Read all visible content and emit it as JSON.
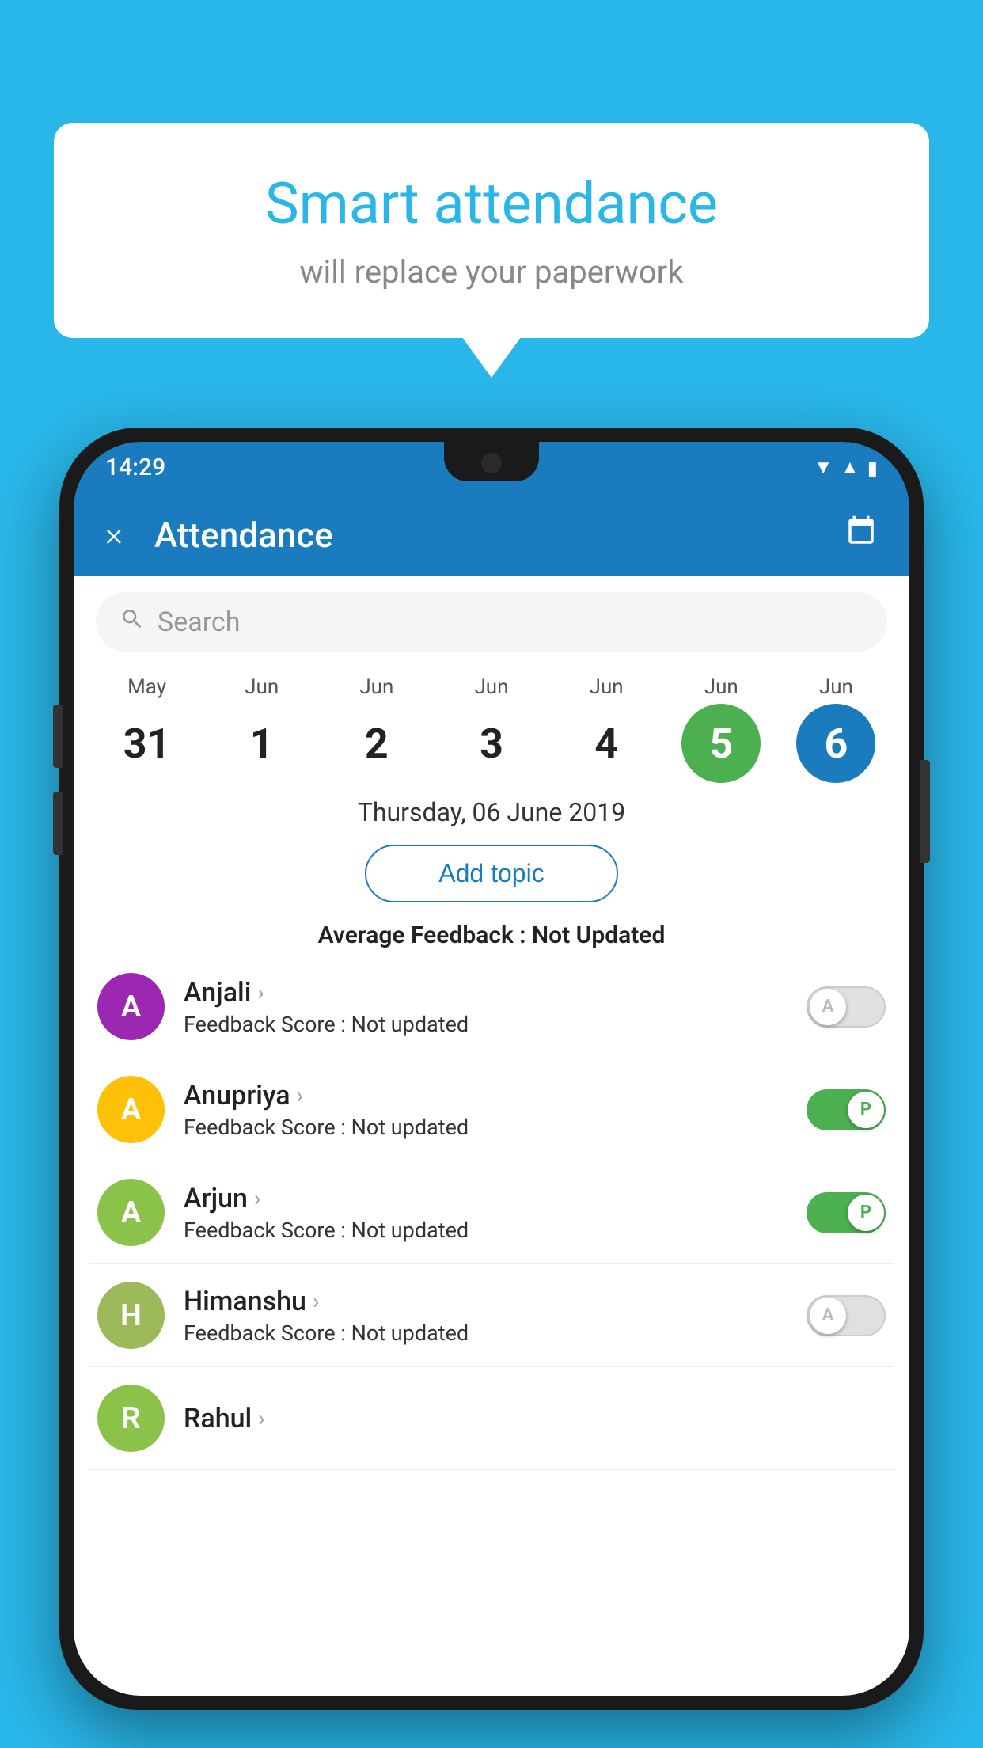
{
  "background_color": "#29b6e8",
  "speech_bubble": {
    "title": "Smart attendance",
    "subtitle": "will replace your paperwork"
  },
  "status_bar": {
    "time": "14:29",
    "wifi_icon": "wifi",
    "signal_icon": "signal",
    "battery_icon": "battery"
  },
  "app_bar": {
    "title": "Attendance",
    "close_label": "×",
    "calendar_icon": "calendar"
  },
  "search": {
    "placeholder": "Search"
  },
  "calendar": {
    "days": [
      {
        "month": "May",
        "num": "31",
        "highlight": ""
      },
      {
        "month": "Jun",
        "num": "1",
        "highlight": ""
      },
      {
        "month": "Jun",
        "num": "2",
        "highlight": ""
      },
      {
        "month": "Jun",
        "num": "3",
        "highlight": ""
      },
      {
        "month": "Jun",
        "num": "4",
        "highlight": ""
      },
      {
        "month": "Jun",
        "num": "5",
        "highlight": "green"
      },
      {
        "month": "Jun",
        "num": "6",
        "highlight": "blue"
      }
    ]
  },
  "selected_date": "Thursday, 06 June 2019",
  "add_topic_label": "Add topic",
  "avg_feedback_label": "Average Feedback : ",
  "avg_feedback_value": "Not Updated",
  "students": [
    {
      "name": "Anjali",
      "avatar_letter": "A",
      "avatar_color": "purple",
      "feedback_label": "Feedback Score : ",
      "feedback_value": "Not updated",
      "toggle": "off",
      "toggle_letter": "A"
    },
    {
      "name": "Anupriya",
      "avatar_letter": "A",
      "avatar_color": "yellow",
      "feedback_label": "Feedback Score : ",
      "feedback_value": "Not updated",
      "toggle": "on",
      "toggle_letter": "P"
    },
    {
      "name": "Arjun",
      "avatar_letter": "A",
      "avatar_color": "green",
      "feedback_label": "Feedback Score : ",
      "feedback_value": "Not updated",
      "toggle": "on",
      "toggle_letter": "P"
    },
    {
      "name": "Himanshu",
      "avatar_letter": "H",
      "avatar_color": "olive",
      "feedback_label": "Feedback Score : ",
      "feedback_value": "Not updated",
      "toggle": "off",
      "toggle_letter": "A"
    }
  ],
  "partial_student": {
    "name": "Rahul",
    "avatar_letter": "R",
    "avatar_color": "green"
  }
}
